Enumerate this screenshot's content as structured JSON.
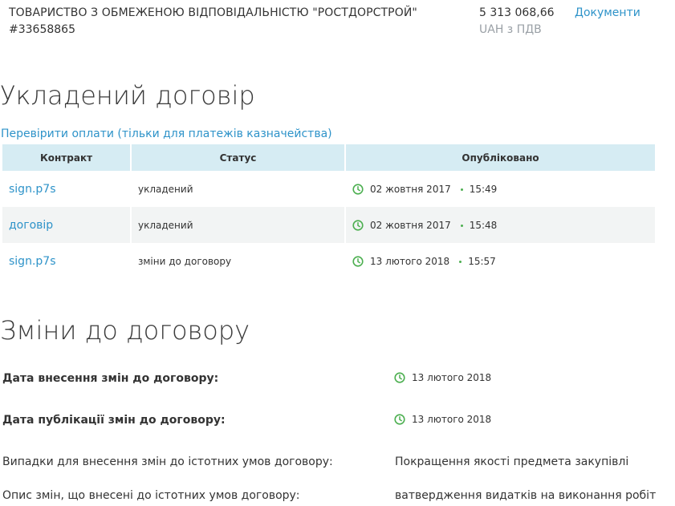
{
  "supplier": {
    "name": "ТОВАРИСТВО З ОБМЕЖЕНОЮ ВІДПОВІДАЛЬНІСТЮ \"РОСТДОРСТРОЙ\"",
    "code": "#33658865",
    "amount": "5 313 068,66",
    "currency": "UAH з ПДВ",
    "docs_link": "Документи"
  },
  "contract_section": {
    "title": "Укладений договір",
    "check_payments_link": "Перевірити оплати (тільки для платежів казначейства)",
    "columns": [
      "Контракт",
      "Статус",
      "Опубліковано"
    ],
    "rows": [
      {
        "file": "sign.p7s",
        "status": "укладений",
        "date": "02 жовтня 2017",
        "time": "15:49"
      },
      {
        "file": "договір",
        "status": "укладений",
        "date": "02 жовтня 2017",
        "time": "15:48"
      },
      {
        "file": "sign.p7s",
        "status": "зміни до договору",
        "date": "13 лютого 2018",
        "time": "15:57"
      }
    ]
  },
  "changes_section": {
    "title": "Зміни до договору",
    "change_date_label": "Дата внесення змін до договору:",
    "change_date_value": "13 лютого 2018",
    "publish_date_label": "Дата публікації змін до договору:",
    "publish_date_value": "13 лютого 2018",
    "cases_label": "Випадки для внесення змін до істотних умов договору:",
    "cases_value": "Покращення якості предмета закупівлі",
    "description_label": "Опис змін, що внесені до істотних умов договору:",
    "description_value": "ватвердження видатків на виконання робіт"
  },
  "colors": {
    "link": "#2e93c9",
    "header_bg": "#d6ecf3",
    "alt_row": "#f2f4f4",
    "clock": "#4caf50"
  },
  "icons": {
    "clock": "clock-icon"
  }
}
